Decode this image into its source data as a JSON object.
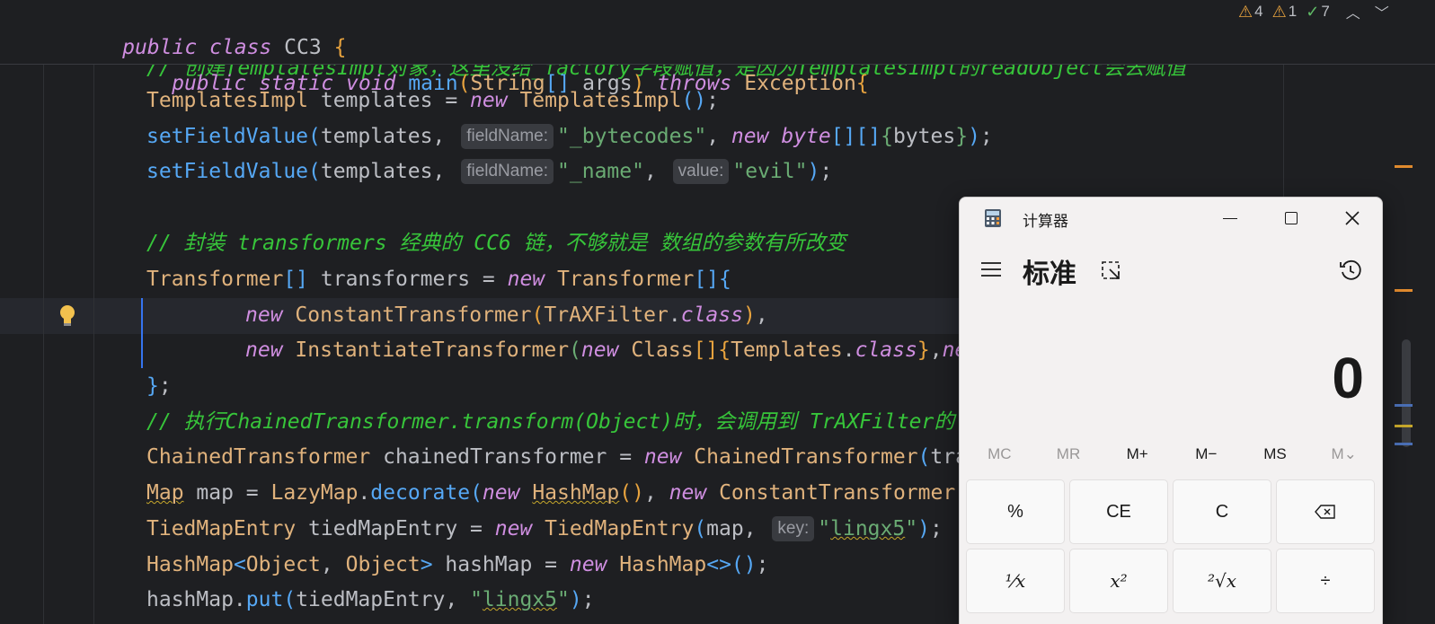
{
  "inspection": {
    "warnings_label": "4",
    "weak_warnings_label": "1",
    "typos_label": "7"
  },
  "editor": {
    "sticky_class_line": [
      "public",
      "class",
      "CC3",
      "{"
    ],
    "sticky_method_line": [
      "public",
      "static",
      "void",
      "main",
      "(",
      "String",
      "[]",
      "args",
      ")",
      "throws",
      "Exception",
      "{"
    ],
    "comment_cut": "// 创建TemplatesImpl对象，这里没给_factory字段赋值，是因为TemplatesImpl的readObject会去赋值",
    "comment_transformers": "// 封装 transformers 经典的 CC6 链，不够就是 数组的参数有所改变",
    "comment_chained": "// 执行ChainedTransformer.transform(Object)时，会调用到 TrAXFilter的",
    "hint_fieldName": "fieldName:",
    "hint_value": "value:",
    "hint_key": "key:",
    "str_bytecodes": "\"_bytecodes\"",
    "str_name": "\"_name\"",
    "str_evil": "\"evil\"",
    "str_lingx5": "lingx5"
  },
  "calculator": {
    "title": "计算器",
    "mode": "标准",
    "display_value": "0",
    "memory_buttons": [
      "MC",
      "MR",
      "M+",
      "M−",
      "MS",
      "M⌄"
    ],
    "keys": [
      "%",
      "CE",
      "C",
      "⌫",
      "¹⁄x",
      "x²",
      "²√x",
      "÷"
    ]
  },
  "icons": {
    "warning": "warning-triangle-icon",
    "weak_warning": "weak-warning-icon",
    "typo": "double-check-icon",
    "bulb": "lightbulb-icon"
  },
  "colors": {
    "editor_bg": "#1e1f22",
    "keyword": "#cf8ee0",
    "type": "#e0b27c",
    "function": "#56a8f5",
    "string": "#6aab73",
    "comment": "#37c53a"
  }
}
